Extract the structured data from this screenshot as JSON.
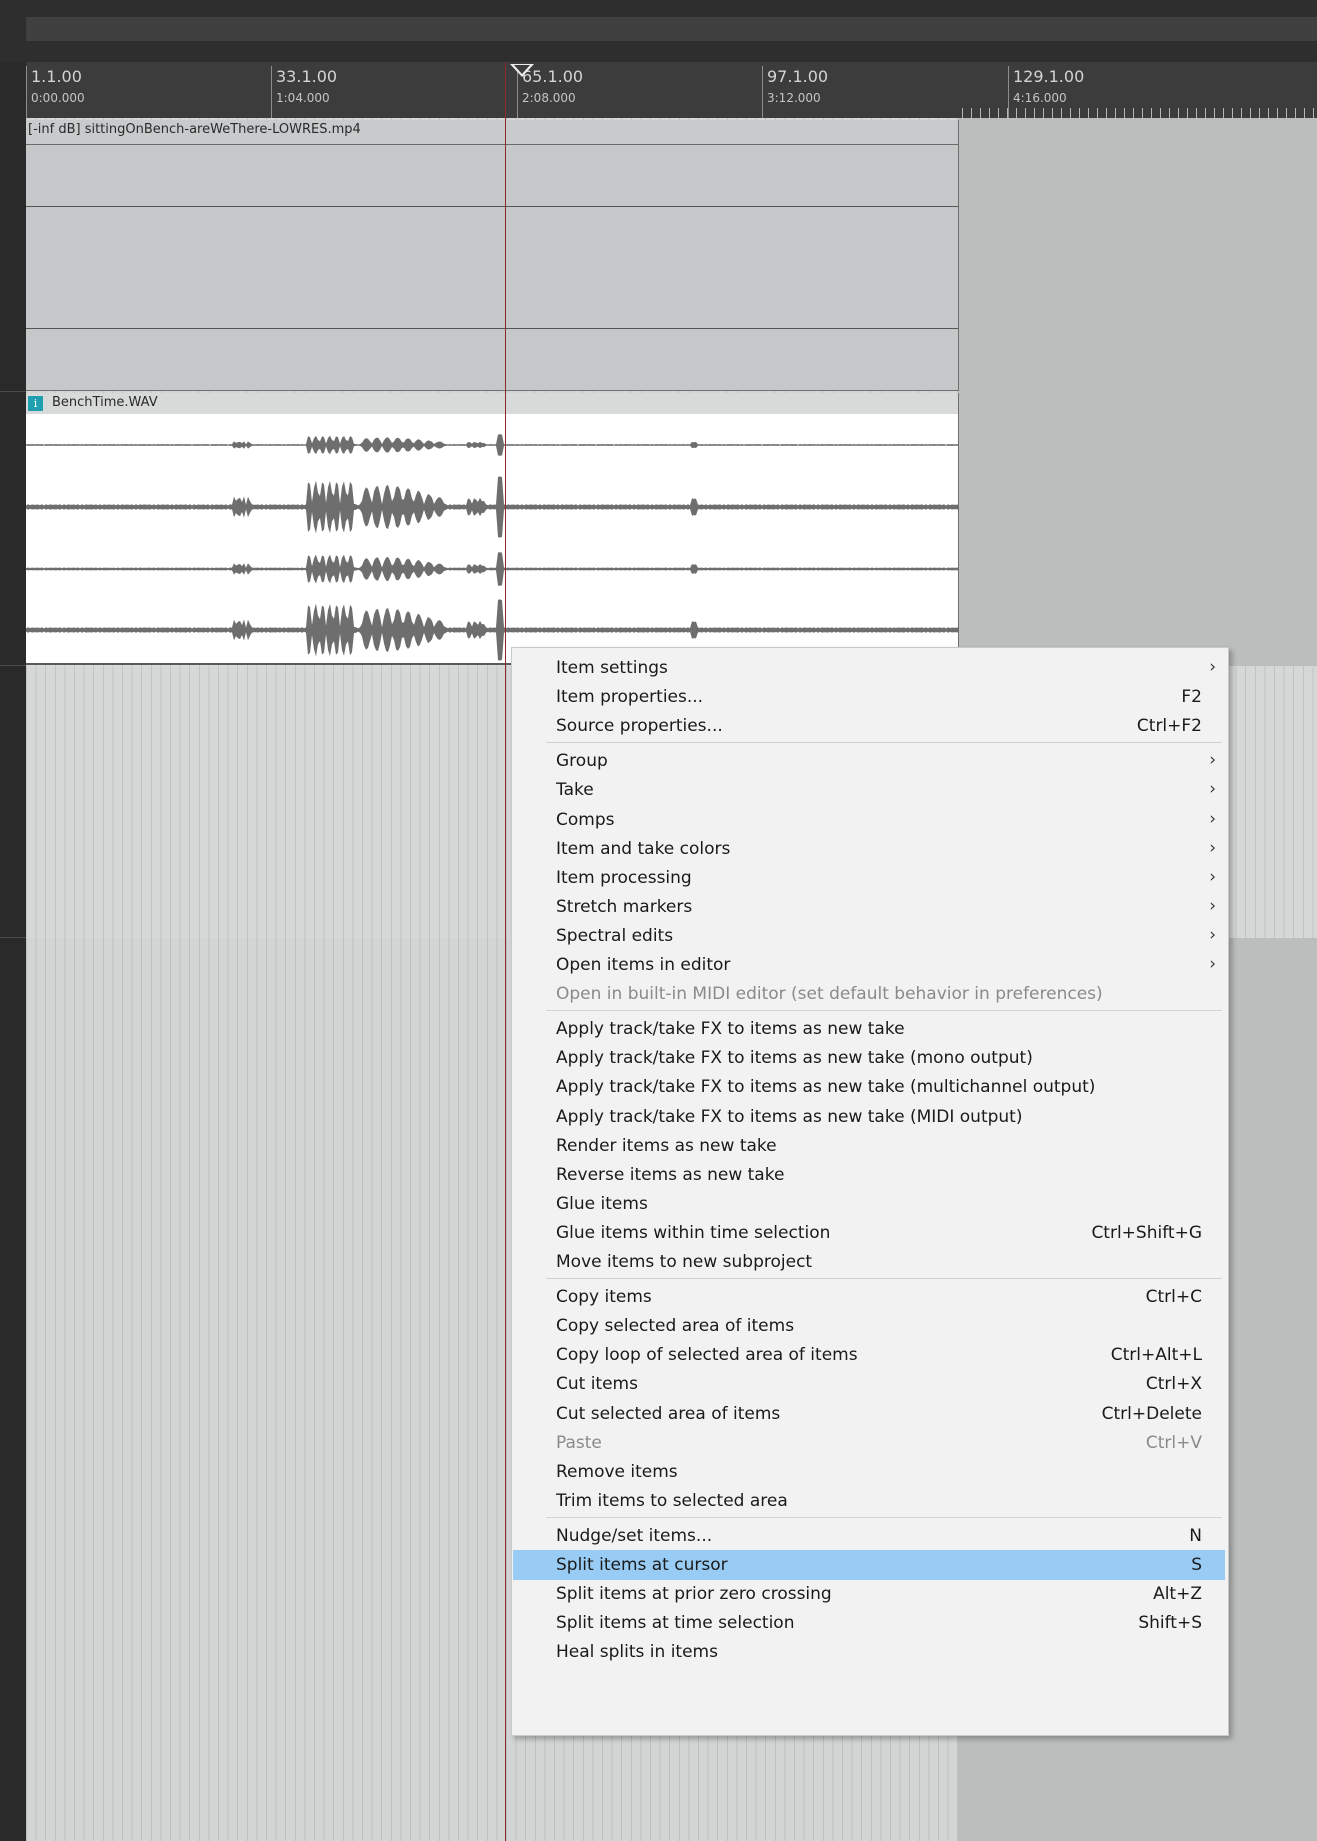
{
  "ruler": {
    "marks": [
      {
        "bar": "1.1.00",
        "time": "0:00.000"
      },
      {
        "bar": "33.1.00",
        "time": "1:04.000"
      },
      {
        "bar": "65.1.00",
        "time": "2:08.000"
      },
      {
        "bar": "97.1.00",
        "time": "3:12.000"
      },
      {
        "bar": "129.1.00",
        "time": "4:16.000"
      }
    ]
  },
  "tracks": {
    "video_item": {
      "title": "[-inf dB] sittingOnBench-areWeThere-LOWRES.mp4"
    },
    "audio_item": {
      "title": "BenchTime.WAV",
      "badge": "i"
    }
  },
  "colors": {
    "highlight": "#99ccf4",
    "playhead": "#8a2a2a",
    "take_badge": "#1f9fb0"
  },
  "icons": {
    "submenu_arrow": "chevron-right-icon",
    "playhead_marker": "triangle-down-icon",
    "take_badge": "info-icon"
  },
  "context_menu": {
    "submenu_glyph": "›",
    "groups": [
      [
        {
          "label": "Item settings",
          "submenu": true
        },
        {
          "label": "Item properties...",
          "shortcut": "F2"
        },
        {
          "label": "Source properties...",
          "shortcut": "Ctrl+F2"
        }
      ],
      [
        {
          "label": "Group",
          "submenu": true
        },
        {
          "label": "Take",
          "submenu": true
        },
        {
          "label": "Comps",
          "submenu": true
        },
        {
          "label": "Item and take colors",
          "submenu": true
        },
        {
          "label": "Item processing",
          "submenu": true
        },
        {
          "label": "Stretch markers",
          "submenu": true
        },
        {
          "label": "Spectral edits",
          "submenu": true
        },
        {
          "label": "Open items in editor",
          "submenu": true
        },
        {
          "label": "Open in built-in MIDI editor (set default behavior in preferences)",
          "disabled": true
        }
      ],
      [
        {
          "label": "Apply track/take FX to items as new take"
        },
        {
          "label": "Apply track/take FX to items as new take (mono output)"
        },
        {
          "label": "Apply track/take FX to items as new take (multichannel output)"
        },
        {
          "label": "Apply track/take FX to items as new take (MIDI output)"
        },
        {
          "label": "Render items as new take"
        },
        {
          "label": "Reverse items as new take"
        },
        {
          "label": "Glue items"
        },
        {
          "label": "Glue items within time selection",
          "shortcut": "Ctrl+Shift+G"
        },
        {
          "label": "Move items to new subproject"
        }
      ],
      [
        {
          "label": "Copy items",
          "shortcut": "Ctrl+C"
        },
        {
          "label": "Copy selected area of items"
        },
        {
          "label": "Copy loop of selected area of items",
          "shortcut": "Ctrl+Alt+L"
        },
        {
          "label": "Cut items",
          "shortcut": "Ctrl+X"
        },
        {
          "label": "Cut selected area of items",
          "shortcut": "Ctrl+Delete"
        },
        {
          "label": "Paste",
          "shortcut": "Ctrl+V",
          "disabled": true
        },
        {
          "label": "Remove items"
        },
        {
          "label": "Trim items to selected area"
        }
      ],
      [
        {
          "label": "Nudge/set items...",
          "shortcut": "N"
        },
        {
          "label": "Split items at cursor",
          "shortcut": "S",
          "highlighted": true
        },
        {
          "label": "Split items at prior zero crossing",
          "shortcut": "Alt+Z"
        },
        {
          "label": "Split items at time selection",
          "shortcut": "Shift+S"
        },
        {
          "label": "Heal splits in items"
        }
      ]
    ]
  }
}
